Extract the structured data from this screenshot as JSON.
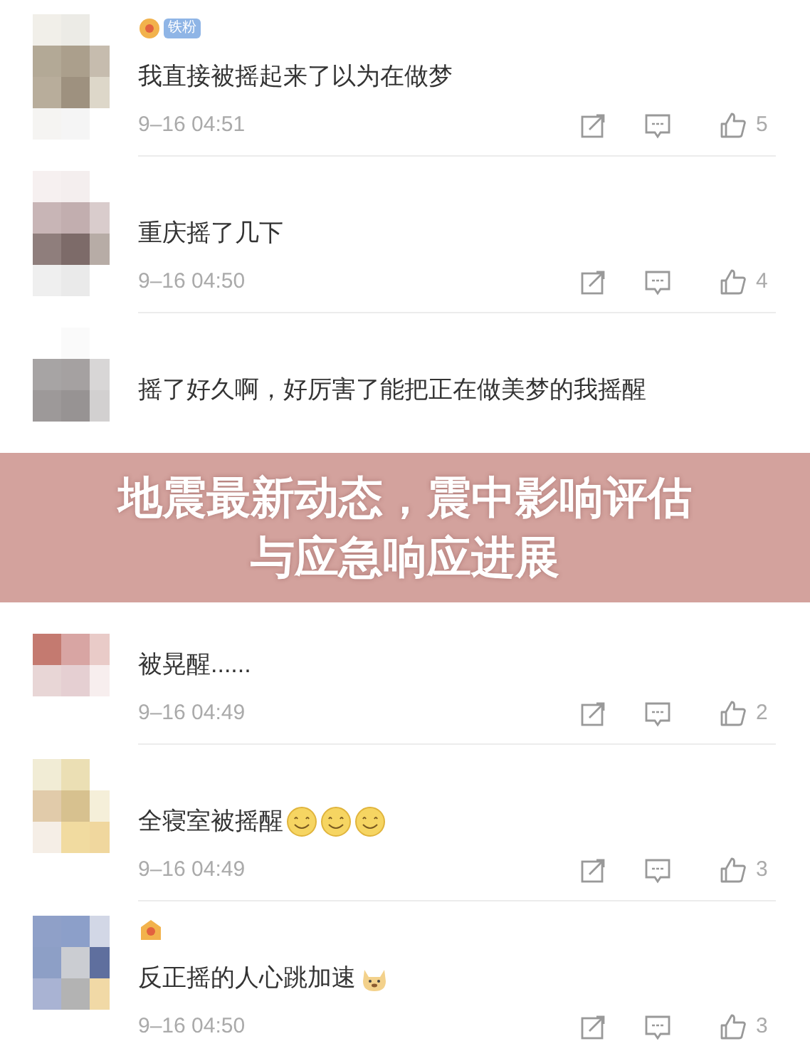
{
  "items": [
    {
      "kind": "comment",
      "badge": "铁粉",
      "text": "我直接被摇起来了以为在做梦",
      "time": "9–16 04:51",
      "likes": "5"
    },
    {
      "kind": "comment",
      "text": "重庆摇了几下",
      "time": "9–16 04:50",
      "likes": "4"
    },
    {
      "kind": "comment",
      "text": "摇了好久啊，好厉害了能把正在做美梦的我摇醒"
    },
    {
      "kind": "banner",
      "title": "地震最新动态，震中影响评估与应急响应进展"
    },
    {
      "kind": "comment",
      "text": "被晃醒......",
      "time": "9–16 04:49",
      "likes": "2"
    },
    {
      "kind": "comment",
      "text": "全寝室被摇醒",
      "emojis": [
        {
          "kind": "smile"
        },
        {
          "kind": "smile"
        },
        {
          "kind": "smile"
        }
      ],
      "time": "9–16 04:49",
      "likes": "3"
    },
    {
      "kind": "comment",
      "badge_icon": true,
      "text": "反正摇的人心跳加速",
      "emojis": [
        {
          "kind": "dog"
        }
      ],
      "time": "9–16 04:50",
      "likes": "3"
    }
  ]
}
